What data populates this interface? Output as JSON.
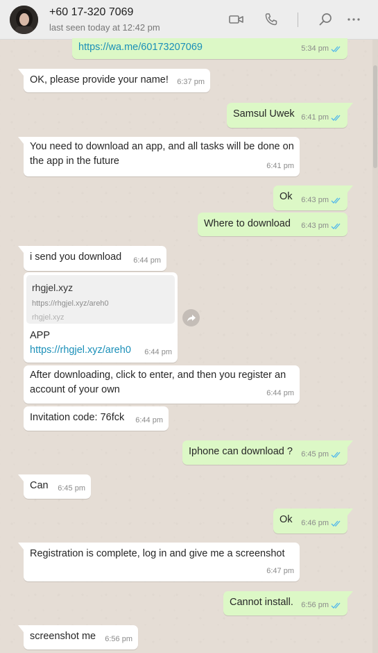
{
  "header": {
    "contact_name": "+60 17-320 7069",
    "last_seen": "last seen today at 12:42 pm",
    "icons": [
      "video-call-icon",
      "voice-call-icon",
      "search-icon",
      "menu-icon"
    ]
  },
  "colors": {
    "incoming_bubble": "#ffffff",
    "outgoing_bubble": "#dcf8c6",
    "chat_background": "#e5ddd5",
    "header_background": "#ededed",
    "link": "#1a8fb8",
    "read_ticks": "#4fb6ec"
  },
  "messages": [
    {
      "dir": "out",
      "text": "https://wa.me/60173207069",
      "time": "5:34 pm",
      "read": true
    },
    {
      "dir": "in",
      "text": "OK, please provide your name!",
      "time": "6:37 pm"
    },
    {
      "dir": "out",
      "text": "Samsul Uwek",
      "time": "6:41 pm",
      "read": true
    },
    {
      "dir": "in",
      "text": "You need to download an app, and all tasks will be done on the app in the future",
      "time": "6:41 pm"
    },
    {
      "dir": "out",
      "text": "Ok",
      "time": "6:43 pm",
      "read": true
    },
    {
      "dir": "out",
      "text": "Where to download",
      "time": "6:43 pm",
      "read": true
    },
    {
      "dir": "in",
      "text": "i send you download",
      "time": "6:44 pm"
    },
    {
      "dir": "in",
      "preview_title": "rhgjel.xyz",
      "preview_url": "https://rhgjel.xyz/areh0",
      "preview_domain": "rhgjel.xyz",
      "text": "APP",
      "link": "https://rhgjel.xyz/areh0",
      "time": "6:44 pm"
    },
    {
      "dir": "in",
      "text": "After downloading, click to enter, and then you register an account of your own",
      "time": "6:44 pm"
    },
    {
      "dir": "in",
      "text": "Invitation code: 76fck",
      "time": "6:44 pm"
    },
    {
      "dir": "out",
      "text": "Iphone can download ?",
      "time": "6:45 pm",
      "read": true
    },
    {
      "dir": "in",
      "text": "Can",
      "time": "6:45 pm"
    },
    {
      "dir": "out",
      "text": "Ok",
      "time": "6:46 pm",
      "read": true
    },
    {
      "dir": "in",
      "text": "Registration is complete, log in and give me a screenshot",
      "time": "6:47 pm"
    },
    {
      "dir": "out",
      "text": "Cannot install.",
      "time": "6:56 pm",
      "read": true
    },
    {
      "dir": "in",
      "text": "screenshot me",
      "time": "6:56 pm"
    }
  ]
}
